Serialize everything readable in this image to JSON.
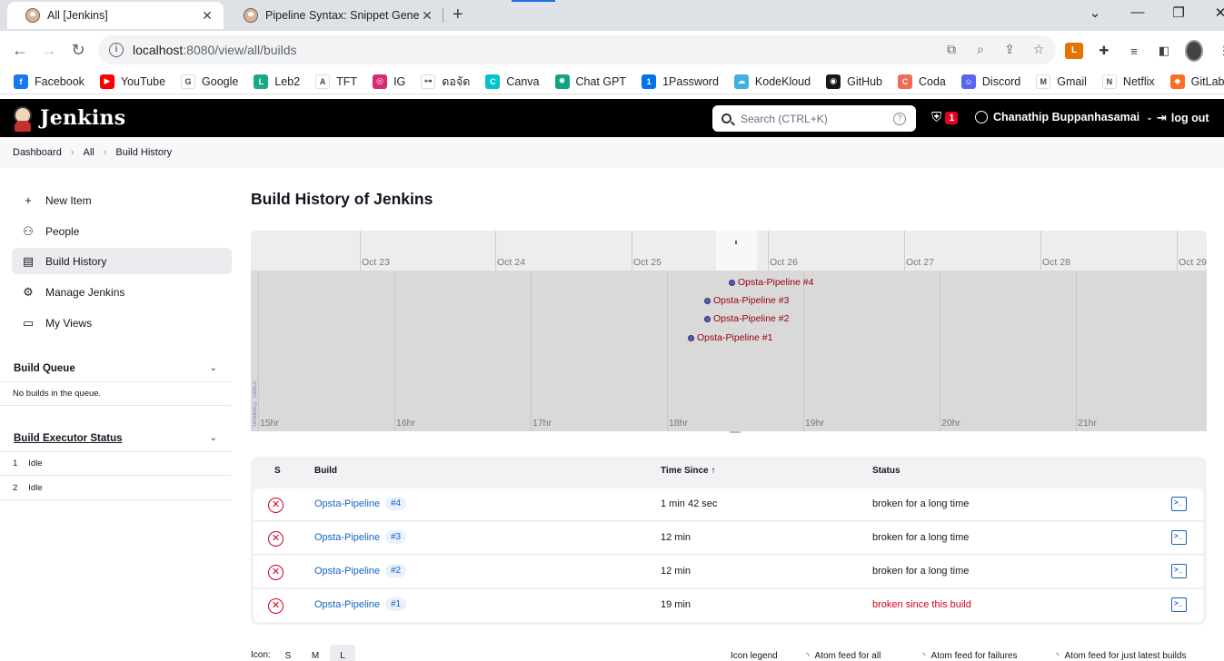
{
  "browser": {
    "tabs": [
      {
        "title": "All [Jenkins]",
        "active": true
      },
      {
        "title": "Pipeline Syntax: Snippet Generat",
        "active": false
      }
    ],
    "url": {
      "host": "localhost",
      "path": ":8080/view/all/builds"
    },
    "bookmarks": [
      {
        "label": "Facebook",
        "icon": "facebook-icon",
        "color": "#1877f2",
        "glyph": "f"
      },
      {
        "label": "YouTube",
        "icon": "youtube-icon",
        "color": "#ff0000",
        "glyph": "▶"
      },
      {
        "label": "Google",
        "icon": "google-icon",
        "color": "#ffffff",
        "glyph": "G"
      },
      {
        "label": "Leb2",
        "icon": "leb2-icon",
        "color": "#1aa88a",
        "glyph": "L"
      },
      {
        "label": "TFT",
        "icon": "tft-icon",
        "color": "#ffffff",
        "glyph": "A"
      },
      {
        "label": "IG",
        "icon": "instagram-icon",
        "color": "#d62976",
        "glyph": "◎"
      },
      {
        "label": "ดอจัด",
        "icon": "link-icon",
        "color": "#ffffff",
        "glyph": "⊶"
      },
      {
        "label": "Canva",
        "icon": "canva-icon",
        "color": "#00c4cc",
        "glyph": "C"
      },
      {
        "label": "Chat GPT",
        "icon": "chatgpt-icon",
        "color": "#10a37f",
        "glyph": "✺"
      },
      {
        "label": "1Password",
        "icon": "1password-icon",
        "color": "#0572ec",
        "glyph": "1"
      },
      {
        "label": "KodeKloud",
        "icon": "kodekloud-icon",
        "color": "#3fb0e0",
        "glyph": "☁"
      },
      {
        "label": "GitHub",
        "icon": "github-icon",
        "color": "#181717",
        "glyph": "◉"
      },
      {
        "label": "Coda",
        "icon": "coda-icon",
        "color": "#f46a54",
        "glyph": "C"
      },
      {
        "label": "Discord",
        "icon": "discord-icon",
        "color": "#5865f2",
        "glyph": "☺"
      },
      {
        "label": "Gmail",
        "icon": "gmail-icon",
        "color": "#ffffff",
        "glyph": "M"
      },
      {
        "label": "Netflix",
        "icon": "netflix-icon",
        "color": "#ffffff",
        "glyph": "N"
      },
      {
        "label": "GitLab",
        "icon": "gitlab-icon",
        "color": "#fc6d26",
        "glyph": "◆"
      }
    ]
  },
  "jenkins": {
    "title": "Jenkins",
    "search_placeholder": "Search (CTRL+K)",
    "security_badge": "1",
    "user": "Chanathip Buppanhasamai",
    "logout": "log out"
  },
  "breadcrumb": [
    "Dashboard",
    "All",
    "Build History"
  ],
  "sidebar": {
    "items": [
      {
        "label": "New Item",
        "icon": "plus-icon"
      },
      {
        "label": "People",
        "icon": "people-icon"
      },
      {
        "label": "Build History",
        "icon": "history-icon"
      },
      {
        "label": "Manage Jenkins",
        "icon": "gear-icon"
      },
      {
        "label": "My Views",
        "icon": "folder-icon"
      }
    ],
    "build_queue": {
      "title": "Build Queue",
      "empty_text": "No builds in the queue."
    },
    "executors": {
      "title": "Build Executor Status",
      "rows": [
        {
          "num": "1",
          "state": "Idle"
        },
        {
          "num": "2",
          "state": "Idle"
        }
      ]
    }
  },
  "main": {
    "title": "Build History of Jenkins",
    "timeline": {
      "dates": [
        "Oct 23",
        "Oct 24",
        "Oct 25",
        "Oct 26",
        "Oct 27",
        "Oct 28",
        "Oct 29"
      ],
      "hours": [
        "15hr",
        "16hr",
        "17hr",
        "18hr",
        "19hr",
        "20hr",
        "21hr"
      ],
      "credit": "Timeline © SIMILE",
      "events": [
        "Opsta-Pipeline #4",
        "Opsta-Pipeline #3",
        "Opsta-Pipeline #2",
        "Opsta-Pipeline #1"
      ]
    },
    "table": {
      "headers": {
        "status": "S",
        "build": "Build",
        "time_since": "Time Since",
        "sort_arrow": "↑",
        "status_col": "Status"
      },
      "rows": [
        {
          "job": "Opsta-Pipeline",
          "num": "#4",
          "time": "1 min 42 sec",
          "status": "broken for a long time",
          "alert": false
        },
        {
          "job": "Opsta-Pipeline",
          "num": "#3",
          "time": "12 min",
          "status": "broken for a long time",
          "alert": false
        },
        {
          "job": "Opsta-Pipeline",
          "num": "#2",
          "time": "12 min",
          "status": "broken for a long time",
          "alert": false
        },
        {
          "job": "Opsta-Pipeline",
          "num": "#1",
          "time": "19 min",
          "status": "broken since this build",
          "alert": true
        }
      ]
    },
    "footer": {
      "icon_label": "Icon:",
      "sizes": [
        "S",
        "M",
        "L"
      ],
      "selected_size": "L",
      "links": [
        "Icon legend",
        "Atom feed for all",
        "Atom feed for failures",
        "Atom feed for just latest builds"
      ]
    }
  },
  "colors": {
    "header_bg": "#000000",
    "link": "#1565c0",
    "failure": "#d2001e",
    "timeline_event": "#96000f"
  }
}
